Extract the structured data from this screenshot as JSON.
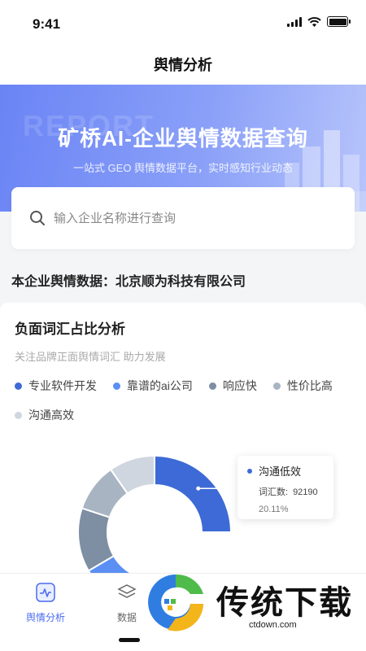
{
  "status_bar": {
    "time": "9:41"
  },
  "nav": {
    "title": "舆情分析"
  },
  "banner": {
    "watermark": "REPORT",
    "title": "矿桥AI-企业舆情数据查询",
    "subtitle": "一站式 GEO 舆情数据平台，实时感知行业动态"
  },
  "search": {
    "placeholder": "输入企业名称进行查询",
    "value": ""
  },
  "company": {
    "line": "本企业舆情数据：北京顺为科技有限公司"
  },
  "analysis": {
    "title": "负面词汇占比分析",
    "subtitle": "关注品牌正面舆情词汇 助力发展",
    "tooltip": {
      "name": "沟通低效",
      "count_label": "词汇数:",
      "count": "92190",
      "percent": "20.11%",
      "color": "#3d6ad6"
    }
  },
  "chart_data": {
    "type": "pie",
    "variant": "donut",
    "title": "负面词汇占比分析",
    "legend_placement": "top-left",
    "series": [
      {
        "name": "专业软件开发",
        "color": "#3d6ad6"
      },
      {
        "name": "靠谱的ai公司",
        "color": "#5b8ff3"
      },
      {
        "name": "响应快",
        "color": "#7e8ea3"
      },
      {
        "name": "性价比高",
        "color": "#a9b4c3"
      },
      {
        "name": "沟通高效",
        "color": "#cfd6e0"
      }
    ],
    "visible_arcs_percent": [
      25,
      17,
      15,
      11
    ],
    "highlighted": {
      "name": "沟通低效",
      "value": 92190,
      "percent": 20.11
    }
  },
  "tabs": [
    {
      "label": "舆情分析",
      "active": true
    },
    {
      "label": "数据",
      "active": false
    }
  ],
  "watermark": {
    "brand": "传统下载",
    "url": "ctdown.com"
  }
}
